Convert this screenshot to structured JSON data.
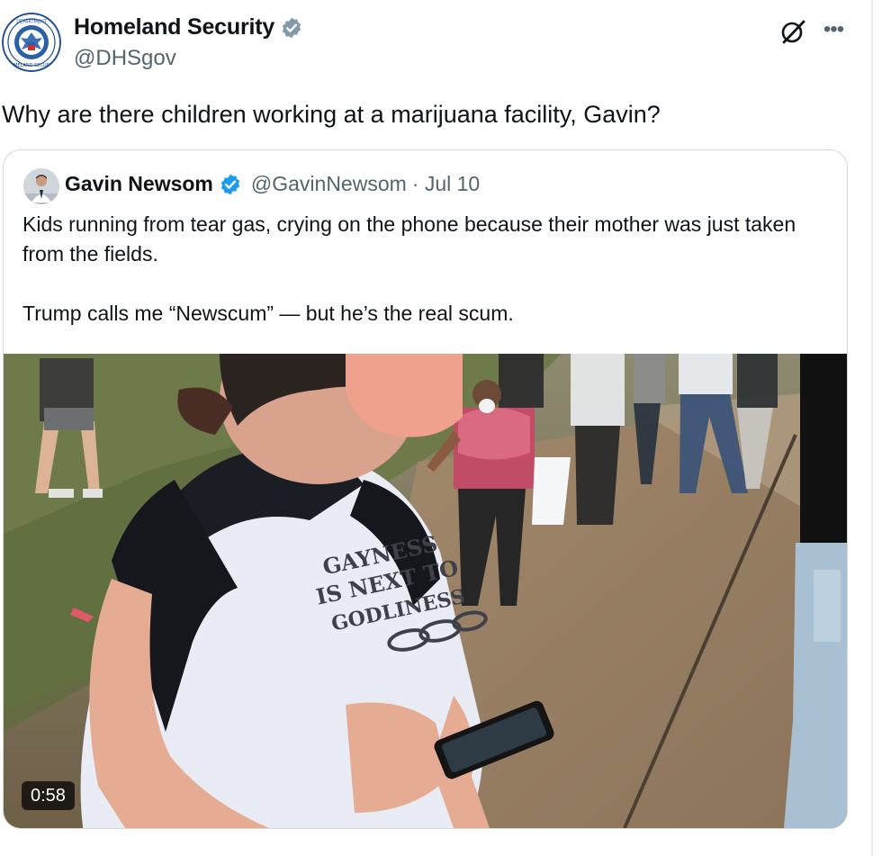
{
  "post": {
    "author_name": "Homeland Security",
    "author_handle": "@DHSgov",
    "text": "Why are there children working at a marijuana facility, Gavin?"
  },
  "quoted": {
    "author_name": "Gavin Newsom",
    "author_handle": "@GavinNewsom",
    "date": "· Jul 10",
    "paragraph1": "Kids running from tear gas, crying on the phone because their mother was just taken from the fields.",
    "paragraph2": "Trump calls me “Newscum” — but he’s the real scum.",
    "video_duration": "0:58",
    "shirt_text": [
      "GAYNESS",
      "IS NEXT TO",
      "GODLINESS"
    ]
  },
  "icons": {
    "verified": "verified-badge-icon",
    "grok": "grok-icon",
    "more": "more-icon"
  },
  "colors": {
    "verified_blue": "#1d9bf0",
    "text_primary": "#0f1419",
    "text_secondary": "#536471",
    "border": "#cfd9de"
  }
}
